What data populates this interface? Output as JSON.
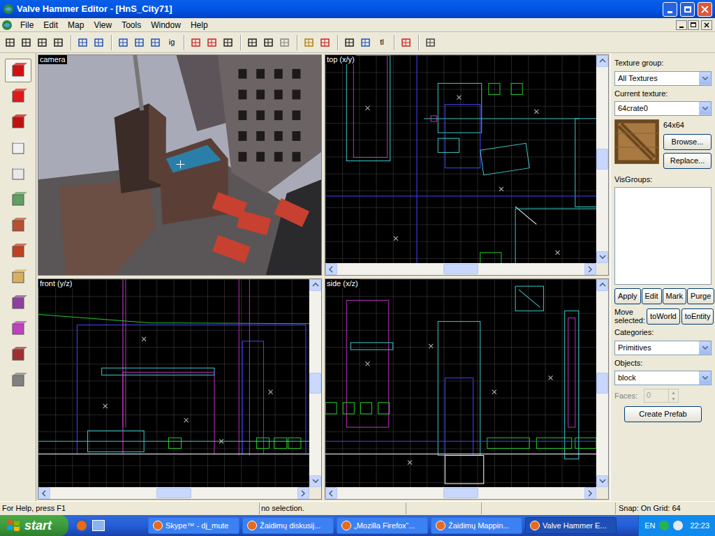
{
  "window": {
    "title": "Valve Hammer Editor - [HnS_City71]"
  },
  "menu": [
    "File",
    "Edit",
    "Map",
    "View",
    "Tools",
    "Window",
    "Help"
  ],
  "toolbar": {
    "text_buttons": [
      "ig",
      "tl"
    ]
  },
  "tools": [
    {
      "selected": true
    },
    {
      "selected": false
    },
    {
      "selected": false
    },
    {
      "selected": false
    },
    {
      "selected": false
    },
    {
      "selected": false
    },
    {
      "selected": false
    },
    {
      "selected": false
    },
    {
      "selected": false
    },
    {
      "selected": false
    },
    {
      "selected": false
    },
    {
      "selected": false
    },
    {
      "selected": false
    }
  ],
  "viewports": [
    {
      "label": "camera",
      "kind": "camera"
    },
    {
      "label": "top (x/y)",
      "kind": "top"
    },
    {
      "label": "front (y/z)",
      "kind": "front"
    },
    {
      "label": "side (x/z)",
      "kind": "side"
    }
  ],
  "texture_group": {
    "label": "Texture group:",
    "value": "All Textures"
  },
  "current_texture": {
    "label": "Current texture:",
    "value": "64crate0",
    "size": "64x64"
  },
  "texture_buttons": [
    "Browse...",
    "Replace..."
  ],
  "visgroups": {
    "label": "VisGroups:",
    "buttons": [
      "Apply",
      "Edit",
      "Mark",
      "Purge"
    ]
  },
  "move_selected": {
    "label": "Move selected:",
    "buttons": [
      "toWorld",
      "toEntity"
    ]
  },
  "categories": {
    "label": "Categories:",
    "value": "Primitives"
  },
  "objects": {
    "label": "Objects:",
    "value": "block"
  },
  "faces": {
    "label": "Faces:",
    "value": "0",
    "disabled": true
  },
  "create_prefab": "Create Prefab",
  "status_bar": {
    "help": "For Help, press F1",
    "selection": "no selection.",
    "snap": "Snap: On Grid: 64"
  },
  "taskbar": {
    "start": "start",
    "tasks": [
      {
        "label": "Skype™ - dj_mute",
        "selected": false
      },
      {
        "label": "Žaidimų diskusij...",
        "selected": false
      },
      {
        "label": "„Mozilla Firefox“...",
        "selected": false
      },
      {
        "label": "Žaidimų Mappin...",
        "selected": false
      },
      {
        "label": "Valve Hammer E...",
        "selected": true
      }
    ],
    "language": "EN",
    "time": "22:23"
  }
}
